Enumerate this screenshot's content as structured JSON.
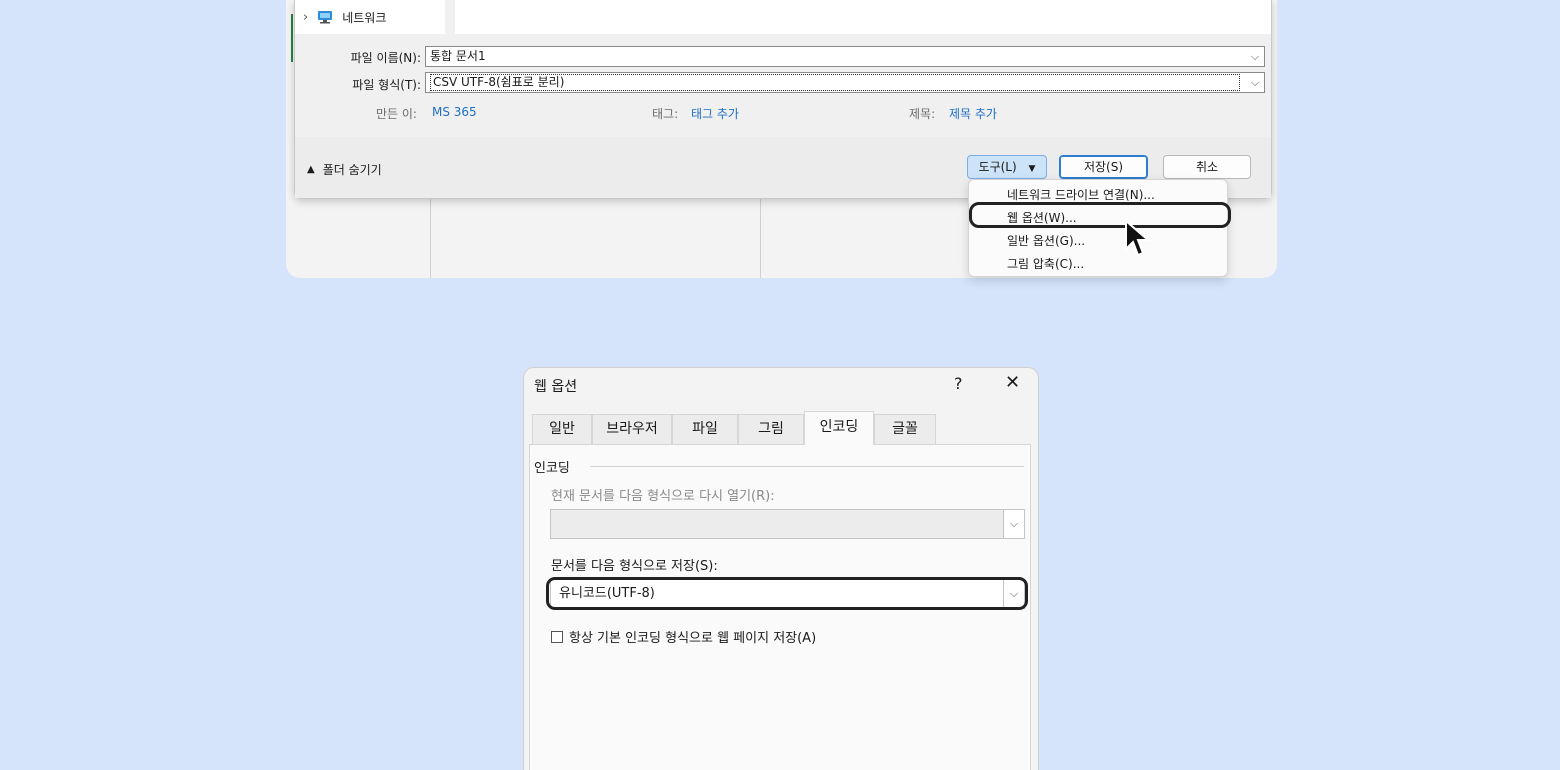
{
  "save_dialog": {
    "nav_item": "네트워크",
    "file_name_label": "파일 이름(N):",
    "file_name_value": "통합 문서1",
    "file_type_label": "파일 형식(T):",
    "file_type_value": "CSV UTF-8(쉼표로 분리)",
    "author_label": "만든 이:",
    "author_value": "MS 365",
    "tags_label": "태그:",
    "tags_value": "태그 추가",
    "title_label": "제목:",
    "title_value": "제목 추가",
    "hide_folders": "폴더 숨기기",
    "tools_button": "도구(L)",
    "save_button": "저장(S)",
    "cancel_button": "취소",
    "tools_menu": [
      "네트워크 드라이브 연결(N)...",
      "웹 옵션(W)...",
      "일반 옵션(G)...",
      "그림 압축(C)..."
    ]
  },
  "web_options": {
    "title": "웹 옵션",
    "help": "?",
    "tabs": [
      "일반",
      "브라우저",
      "파일",
      "그림",
      "인코딩",
      "글꼴"
    ],
    "active_tab": "인코딩",
    "group_title": "인코딩",
    "reopen_label": "현재 문서를 다음 형식으로 다시 열기(R):",
    "reopen_value": "",
    "save_as_label": "문서를 다음 형식으로 저장(S):",
    "save_as_value": "유니코드(UTF-8)",
    "always_save_label": "항상 기본 인코딩 형식으로 웹 페이지 저장(A)",
    "always_save_checked": false
  },
  "colors": {
    "background": "#d6e4fb",
    "link_blue": "#1c6fc1",
    "highlight_outline": "#222222"
  }
}
